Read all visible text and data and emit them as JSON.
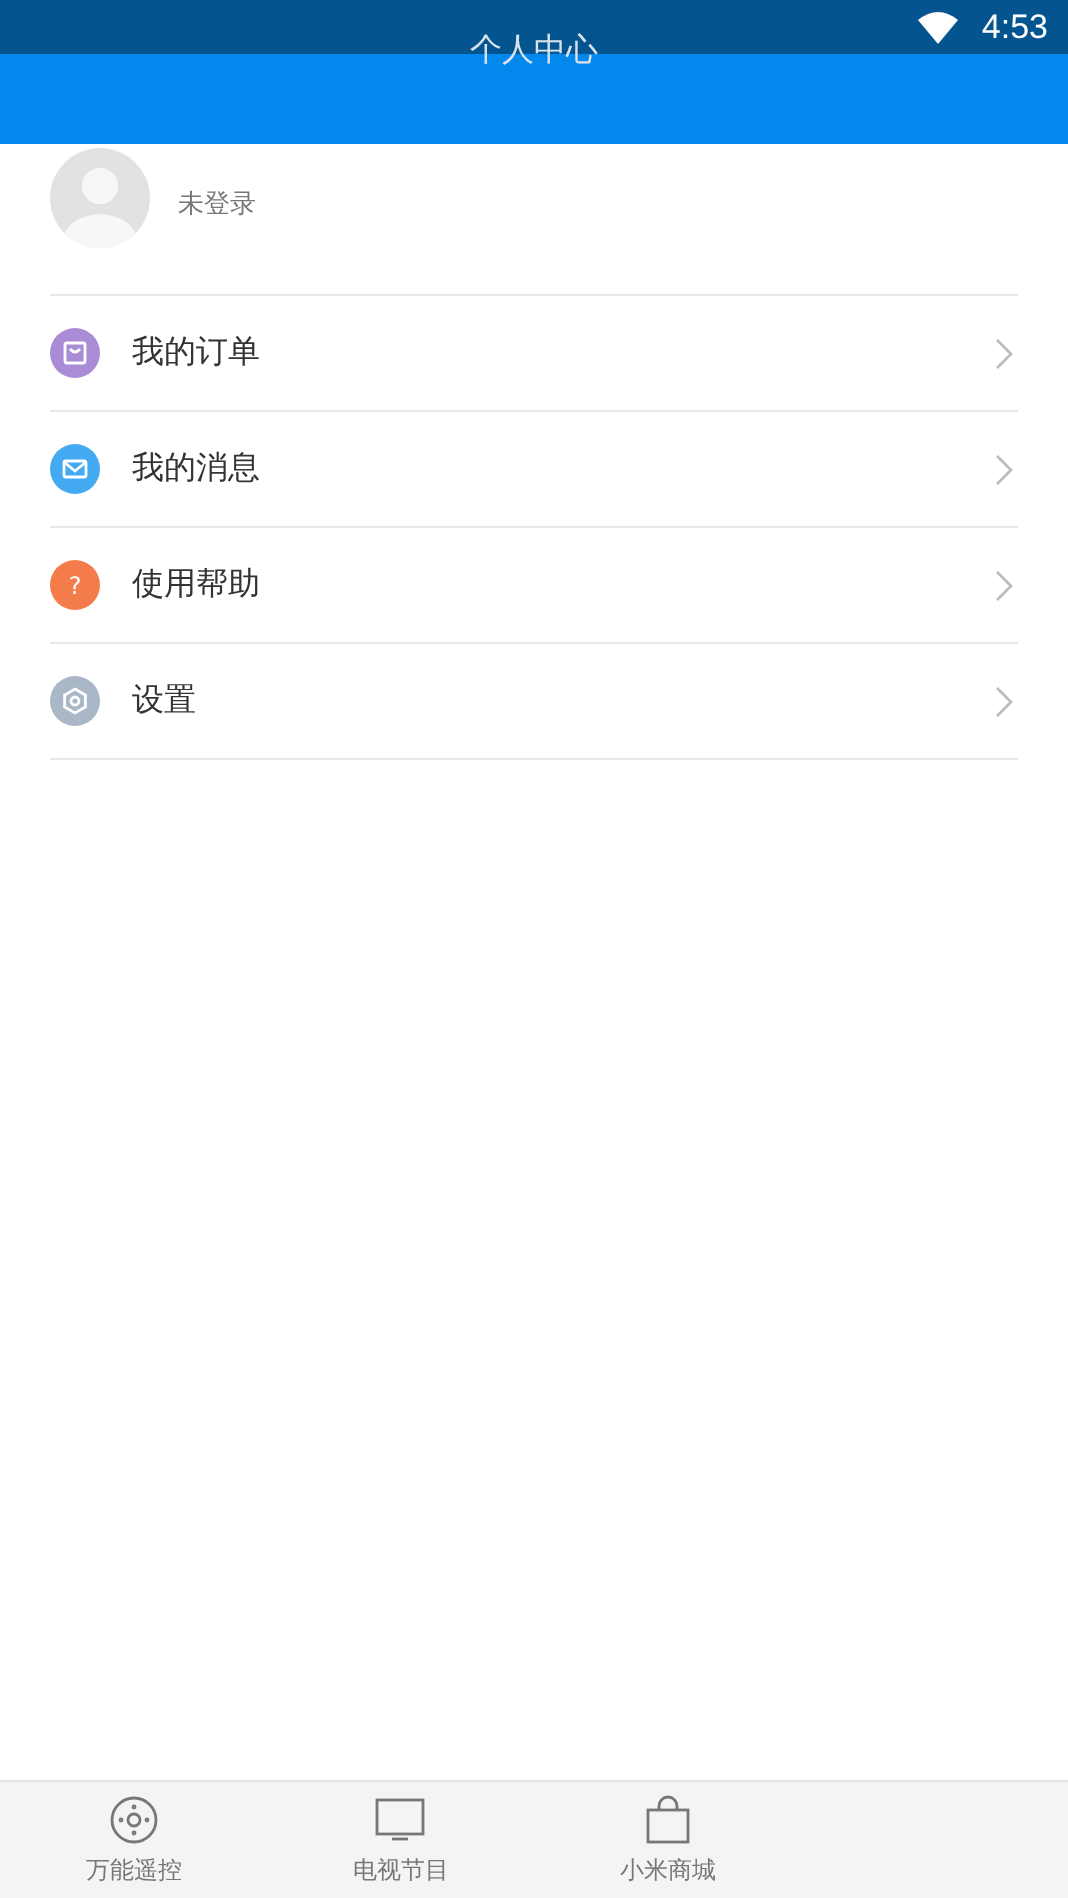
{
  "status_bar": {
    "time": "4:53"
  },
  "header": {
    "title": "个人中心"
  },
  "profile": {
    "name": "未登录"
  },
  "menu": [
    {
      "kind": "orders",
      "label": "我的订单",
      "color": "#a98bd6"
    },
    {
      "kind": "messages",
      "label": "我的消息",
      "color": "#43aaf2"
    },
    {
      "kind": "help",
      "label": "使用帮助",
      "color": "#f47c4a",
      "glyph": "?"
    },
    {
      "kind": "settings",
      "label": "设置",
      "color": "#a9b7c6"
    }
  ],
  "bottom_nav": [
    {
      "kind": "remote",
      "label": "万能遥控",
      "selected": false
    },
    {
      "kind": "tv",
      "label": "电视节目",
      "selected": false
    },
    {
      "kind": "shop",
      "label": "小米商城",
      "selected": false
    }
  ]
}
